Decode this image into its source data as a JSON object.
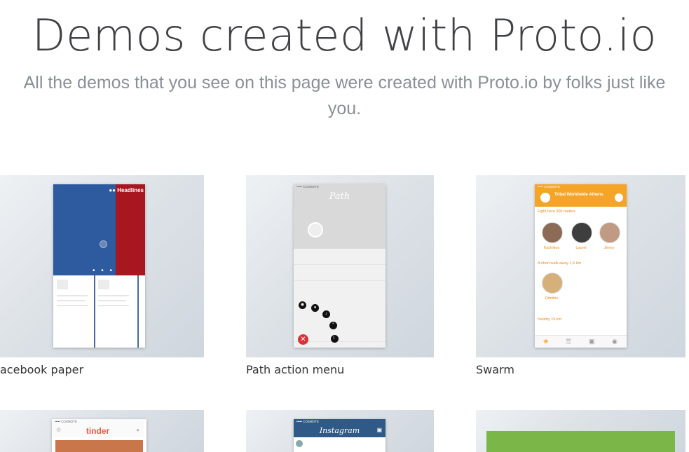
{
  "header": {
    "title": "Demos created with Proto.io",
    "subtitle_line1": "All the demos that you see on this page were created with Proto.io by folks just like",
    "subtitle_line2": "you."
  },
  "demos": [
    {
      "caption": "acebook paper",
      "screen": {
        "headline": "Headlines",
        "dots": "• • •"
      }
    },
    {
      "caption": "Path action menu",
      "screen": {
        "status": "••••• COSMOTE",
        "logo": "Path"
      }
    },
    {
      "caption": "Swarm",
      "screen": {
        "status": "••••• COSMOTE",
        "bar_title": "Tribal Worldwide Athens",
        "fight_label": "Fight here 300 meters",
        "walk_label": "A short walk away 1,5 km",
        "nearby_label": "Nearby 15 km",
        "people": [
          "Kachikos",
          "Laurel",
          "Jenny"
        ],
        "person_walk": "Dimitris"
      }
    },
    {
      "caption": "",
      "screen": {
        "status": "••••• COSMOTE",
        "logo": "tinder"
      }
    },
    {
      "caption": "",
      "screen": {
        "status": "••••• COSMOTE",
        "logo": "Instagram"
      }
    },
    {
      "caption": "",
      "screen": {}
    }
  ],
  "colors": {
    "fb_blue": "#2e5a9f",
    "fb_red": "#a8161f",
    "swarm_orange": "#f5a428",
    "tinder": "#f0573d",
    "instagram": "#2f5a87",
    "green": "#7ab648"
  }
}
